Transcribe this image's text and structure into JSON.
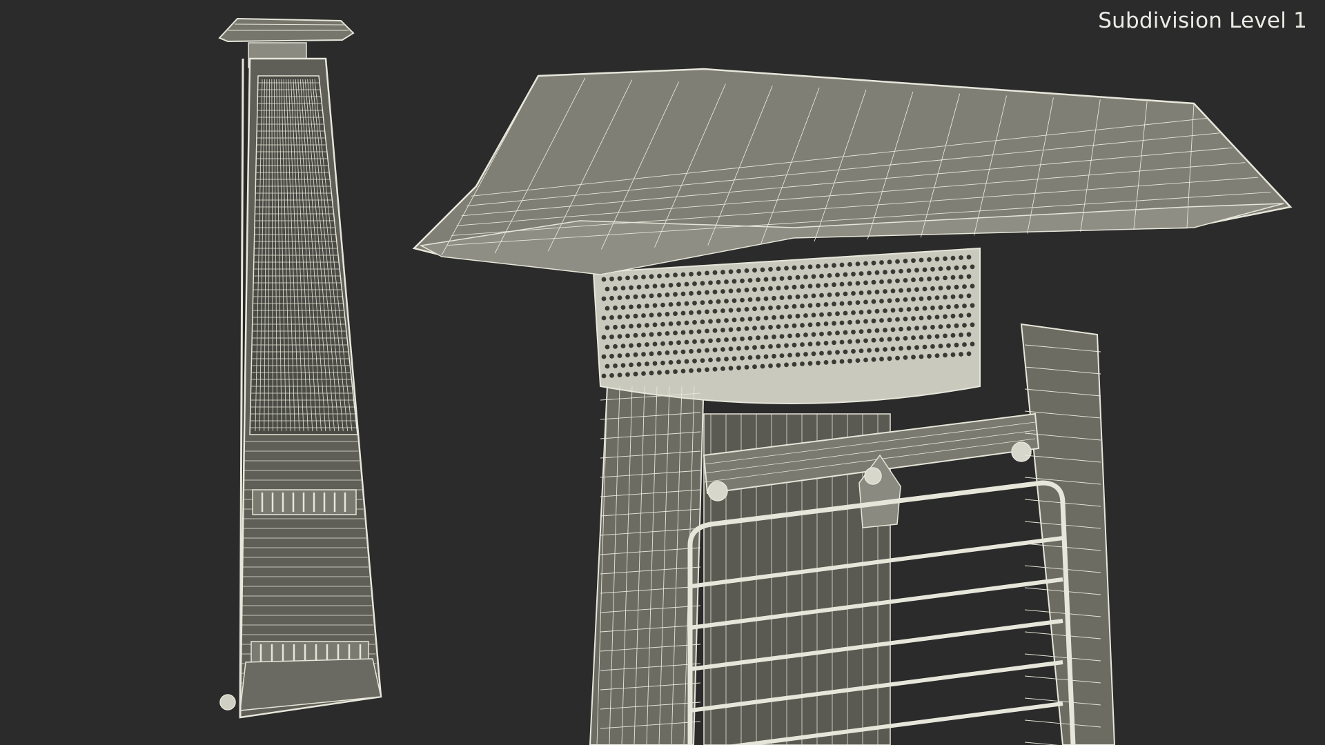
{
  "viewport": {
    "subdivision_label": "Subdivision Level 1",
    "background_color": "#2b2b2b",
    "wire_color": "#e6e6da",
    "surface_color": "#6f6f66"
  },
  "views": [
    {
      "name": "full-view",
      "subject": "pyramid patio heater wireframe"
    },
    {
      "name": "closeup-view",
      "subject": "patio heater top cap wireframe"
    }
  ]
}
